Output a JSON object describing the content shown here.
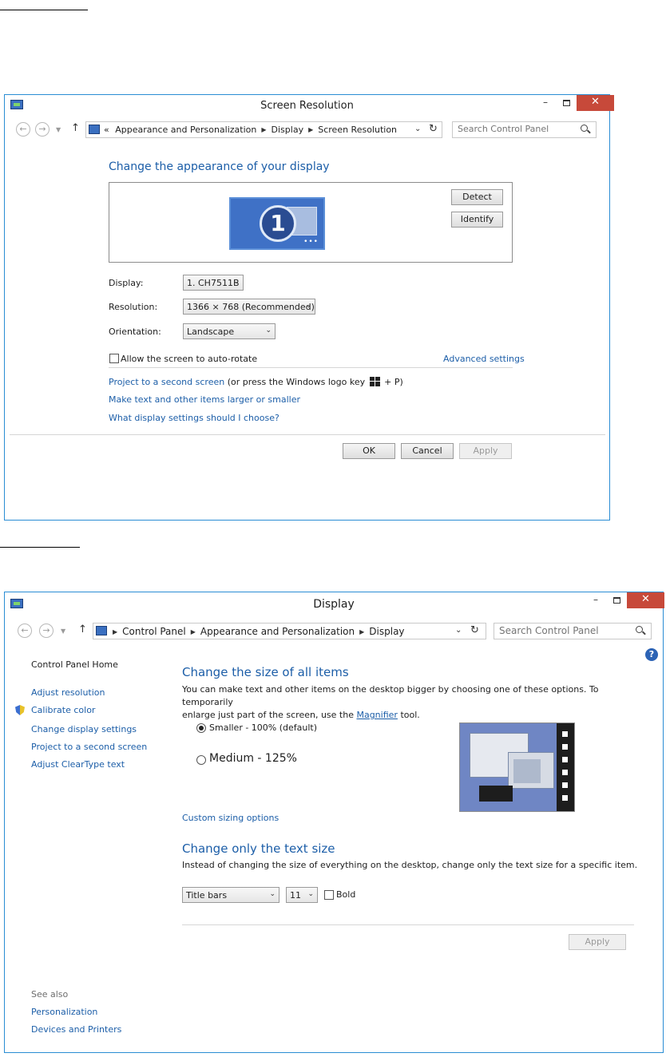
{
  "window1": {
    "title": "Screen Resolution",
    "close_glyph": "✕",
    "breadcrumb_prefix": "«",
    "breadcrumbs": [
      "Appearance and Personalization",
      "Display",
      "Screen Resolution"
    ],
    "search_placeholder": "Search Control Panel",
    "heading": "Change the appearance of your display",
    "detect_label": "Detect",
    "identify_label": "Identify",
    "monitor_number": "1",
    "display_label": "Display:",
    "display_value": "1. CH7511B",
    "resolution_label": "Resolution:",
    "resolution_value": "1366 × 768 (Recommended)",
    "orientation_label": "Orientation:",
    "orientation_value": "Landscape",
    "autorotate_label": "Allow the screen to auto-rotate",
    "advanced_settings": "Advanced settings",
    "project_link": "Project to a second screen",
    "project_suffix_pre": "(or press the Windows logo key",
    "project_suffix_post": "+ P)",
    "text_size_link": "Make text and other items larger or smaller",
    "which_settings_link": "What display settings should I choose?",
    "ok_label": "OK",
    "cancel_label": "Cancel",
    "apply_label": "Apply"
  },
  "window2": {
    "title": "Display",
    "close_glyph": "✕",
    "breadcrumbs": [
      "Control Panel",
      "Appearance and Personalization",
      "Display"
    ],
    "search_placeholder": "Search Control Panel",
    "help_glyph": "?",
    "sidebar": {
      "home": "Control Panel Home",
      "items": [
        "Adjust resolution",
        "Calibrate color",
        "Change display settings",
        "Project to a second screen",
        "Adjust ClearType text"
      ],
      "see_also": "See also",
      "see_also_items": [
        "Personalization",
        "Devices and Printers"
      ]
    },
    "heading1": "Change the size of all items",
    "desc1_a": "You can make text and other items on the desktop bigger by choosing one of these options. To temporarily",
    "desc1_b": "enlarge just part of the screen, use the",
    "magnifier": "Magnifier",
    "desc1_c": "tool.",
    "option_smaller": "Smaller - 100% (default)",
    "option_medium": "Medium - 125%",
    "custom_sizing": "Custom sizing options",
    "heading2": "Change only the text size",
    "desc2": "Instead of changing the size of everything on the desktop, change only the text size for a specific item.",
    "item_select": "Title bars",
    "size_select": "11",
    "bold_label": "Bold",
    "apply_label": "Apply"
  }
}
